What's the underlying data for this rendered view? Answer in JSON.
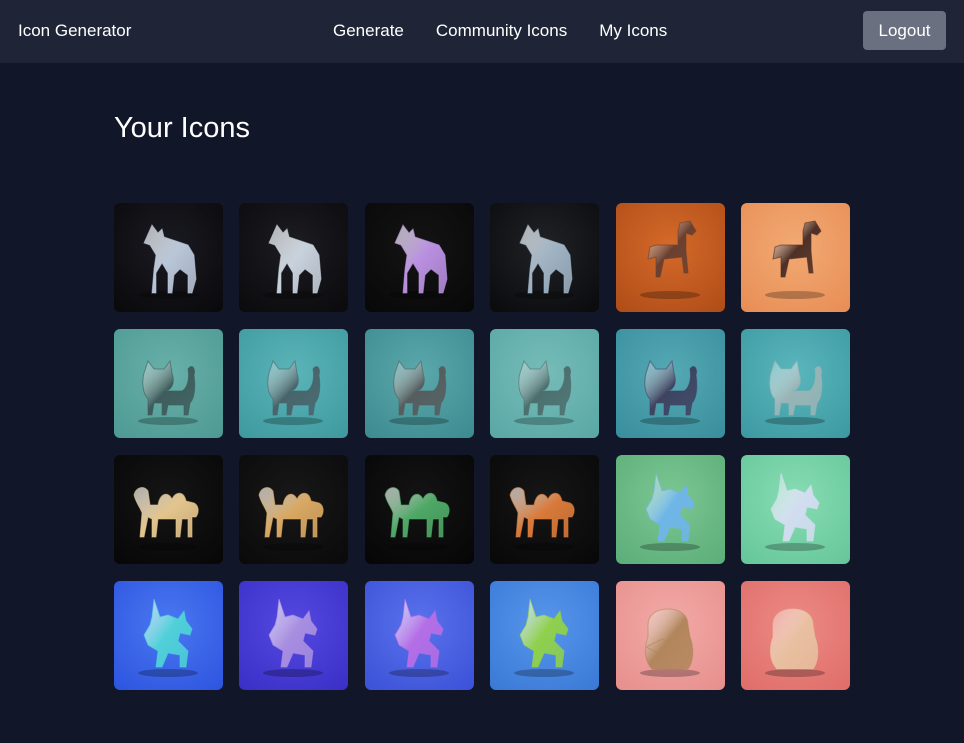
{
  "header": {
    "brand": "Icon Generator",
    "nav": [
      "Generate",
      "Community Icons",
      "My Icons"
    ],
    "logout_label": "Logout"
  },
  "page": {
    "title": "Your Icons"
  },
  "icons": [
    {
      "subject": "wolf",
      "style": "glass",
      "bg": "#0a0a0c",
      "bg2": "#1a1a22",
      "fg": "#b9c6d8"
    },
    {
      "subject": "wolf",
      "style": "glass",
      "bg": "#0b0b0d",
      "bg2": "#1c1c22",
      "fg": "#c8d2dc"
    },
    {
      "subject": "wolf",
      "style": "iridescent",
      "bg": "#080808",
      "bg2": "#141414",
      "fg": "#b98fe0"
    },
    {
      "subject": "wolf",
      "style": "glass",
      "bg": "#0a0b0d",
      "bg2": "#202226",
      "fg": "#9fb3c4"
    },
    {
      "subject": "horse",
      "style": "wood",
      "bg": "#b04d18",
      "bg2": "#d46a2a",
      "fg": "#6a4030"
    },
    {
      "subject": "horse",
      "style": "wood",
      "bg": "#e88e56",
      "bg2": "#f2aa73",
      "fg": "#4e3026"
    },
    {
      "subject": "cat",
      "style": "clay",
      "bg": "#4f9a94",
      "bg2": "#68b0a9",
      "fg": "#3e5c5b"
    },
    {
      "subject": "cat",
      "style": "clay",
      "bg": "#3f9aa0",
      "bg2": "#5ab4b8",
      "fg": "#48646a"
    },
    {
      "subject": "cat",
      "style": "clay",
      "bg": "#3e8c91",
      "bg2": "#5aa8ab",
      "fg": "#555d5e"
    },
    {
      "subject": "cat",
      "style": "clay",
      "bg": "#5aa8a6",
      "bg2": "#76bcb8",
      "fg": "#4c6f6e"
    },
    {
      "subject": "cat",
      "style": "clay",
      "bg": "#3a8f9d",
      "bg2": "#55a9b5",
      "fg": "#3e4360"
    },
    {
      "subject": "cat",
      "style": "clay",
      "bg": "#3e9aa2",
      "bg2": "#5ab6bc",
      "fg": "#98b4b6"
    },
    {
      "subject": "camel",
      "style": "gold",
      "bg": "#070707",
      "bg2": "#151515",
      "fg": "#e3c48c"
    },
    {
      "subject": "camel",
      "style": "gold",
      "bg": "#0a0a0a",
      "bg2": "#181818",
      "fg": "#d8a862"
    },
    {
      "subject": "camel",
      "style": "iridescent",
      "bg": "#060606",
      "bg2": "#141414",
      "fg": "#4ea866"
    },
    {
      "subject": "camel",
      "style": "iridescent",
      "bg": "#080808",
      "bg2": "#161616",
      "fg": "#d87a3a"
    },
    {
      "subject": "unicorn",
      "style": "lowpoly",
      "bg": "#5cae7a",
      "bg2": "#7cc792",
      "fg": "#6fb6e8"
    },
    {
      "subject": "unicorn",
      "style": "lowpoly",
      "bg": "#66c79a",
      "bg2": "#88dcb4",
      "fg": "#d2ddf0"
    },
    {
      "subject": "unicorn",
      "style": "chrome",
      "bg": "#2e55e0",
      "bg2": "#4a78f0",
      "fg": "#4fd0d8"
    },
    {
      "subject": "unicorn",
      "style": "chrome",
      "bg": "#3a30c8",
      "bg2": "#5448e0",
      "fg": "#a88ee0"
    },
    {
      "subject": "unicorn",
      "style": "chrome",
      "bg": "#3c52d8",
      "bg2": "#5a72ec",
      "fg": "#b46ee6"
    },
    {
      "subject": "unicorn",
      "style": "chrome",
      "bg": "#3a7ad6",
      "bg2": "#5896ec",
      "fg": "#8fd04c"
    },
    {
      "subject": "capybara",
      "style": "clay",
      "bg": "#e7908e",
      "bg2": "#f2aaa6",
      "fg": "#b2865c"
    },
    {
      "subject": "capybara",
      "style": "clay",
      "bg": "#e06e6a",
      "bg2": "#ec8a84",
      "fg": "#e8c0a0"
    }
  ]
}
